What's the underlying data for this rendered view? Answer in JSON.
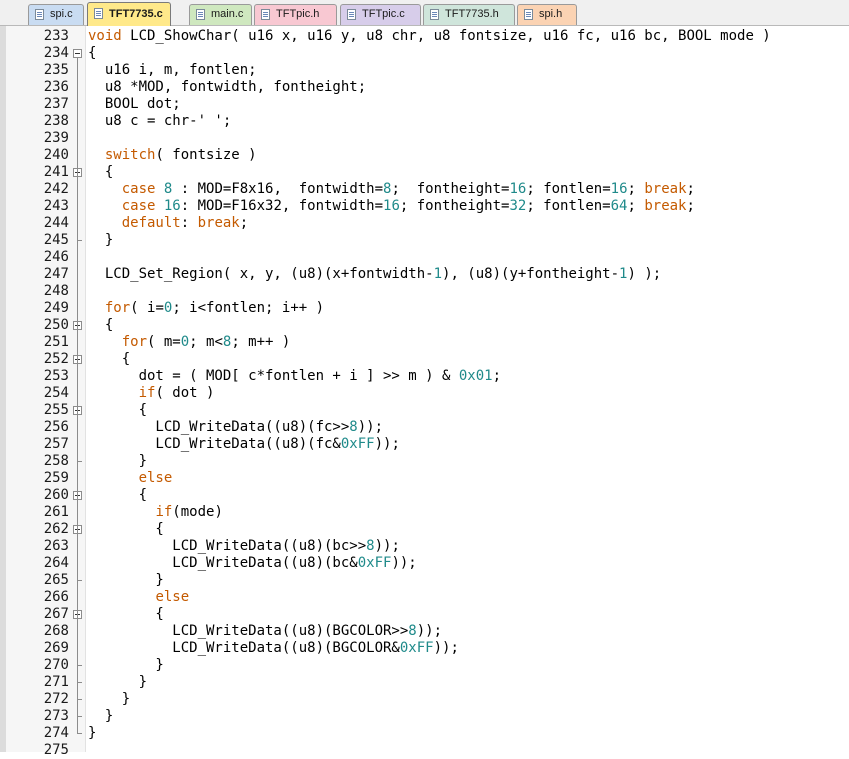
{
  "tabs": [
    {
      "label": "spi.c",
      "color": "#c9dcf2"
    },
    {
      "label": "TFT7735.c",
      "color": "#ffe98a",
      "active": true
    },
    {
      "label": "main.c",
      "color": "#cfe8bf"
    },
    {
      "label": "TFTpic.h",
      "color": "#f8c8d2"
    },
    {
      "label": "TFTpic.c",
      "color": "#d7cdea"
    },
    {
      "label": "TFT7735.h",
      "color": "#cfe5db"
    },
    {
      "label": "spi.h",
      "color": "#fbd3b3"
    }
  ],
  "colors": {
    "keyword": "#c45a00",
    "number": "#1f8a8a",
    "text": "#000000",
    "gutter": "#f6f6f6"
  },
  "editor": {
    "first_line": 233,
    "lines": [
      {
        "n": "233",
        "t": [
          [
            "void",
            "kw"
          ],
          [
            " LCD_ShowChar( u16 x, u16 y, u8 chr, u8 fontsize, u16 fc, u16 bc, BOOL mode )",
            ""
          ]
        ]
      },
      {
        "n": "234",
        "fold": true,
        "t": [
          [
            "{",
            ""
          ]
        ]
      },
      {
        "n": "235",
        "t": [
          [
            "  u16 i, m, fontlen;",
            ""
          ]
        ]
      },
      {
        "n": "236",
        "t": [
          [
            "  u8 *MOD, fontwidth, fontheight;",
            ""
          ]
        ]
      },
      {
        "n": "237",
        "t": [
          [
            "  BOOL dot;",
            ""
          ]
        ]
      },
      {
        "n": "238",
        "t": [
          [
            "  u8 c = chr-' ';",
            ""
          ]
        ]
      },
      {
        "n": "239",
        "t": []
      },
      {
        "n": "240",
        "t": [
          [
            "  ",
            ""
          ],
          [
            "switch",
            "kw"
          ],
          [
            "( fontsize )",
            ""
          ]
        ]
      },
      {
        "n": "241",
        "fold": true,
        "t": [
          [
            "  {",
            ""
          ]
        ]
      },
      {
        "n": "242",
        "t": [
          [
            "    ",
            ""
          ],
          [
            "case",
            "kw"
          ],
          [
            " ",
            ""
          ],
          [
            "8",
            "num"
          ],
          [
            " : MOD=F8x16,  fontwidth=",
            ""
          ],
          [
            "8",
            "num"
          ],
          [
            ";  fontheight=",
            ""
          ],
          [
            "16",
            "num"
          ],
          [
            "; fontlen=",
            ""
          ],
          [
            "16",
            "num"
          ],
          [
            "; ",
            ""
          ],
          [
            "break",
            "kw"
          ],
          [
            ";",
            ""
          ]
        ]
      },
      {
        "n": "243",
        "t": [
          [
            "    ",
            ""
          ],
          [
            "case",
            "kw"
          ],
          [
            " ",
            ""
          ],
          [
            "16",
            "num"
          ],
          [
            ": MOD=F16x32, fontwidth=",
            ""
          ],
          [
            "16",
            "num"
          ],
          [
            "; fontheight=",
            ""
          ],
          [
            "32",
            "num"
          ],
          [
            "; fontlen=",
            ""
          ],
          [
            "64",
            "num"
          ],
          [
            "; ",
            ""
          ],
          [
            "break",
            "kw"
          ],
          [
            ";",
            ""
          ]
        ]
      },
      {
        "n": "244",
        "t": [
          [
            "    ",
            ""
          ],
          [
            "default",
            "kw"
          ],
          [
            ": ",
            ""
          ],
          [
            "break",
            "kw"
          ],
          [
            ";",
            ""
          ]
        ]
      },
      {
        "n": "245",
        "t": [
          [
            "  }",
            ""
          ]
        ]
      },
      {
        "n": "246",
        "t": []
      },
      {
        "n": "247",
        "t": [
          [
            "  LCD_Set_Region( x, y, (u8)(x+fontwidth-",
            ""
          ],
          [
            "1",
            "num"
          ],
          [
            "), (u8)(y+fontheight-",
            ""
          ],
          [
            "1",
            "num"
          ],
          [
            ") );",
            ""
          ]
        ]
      },
      {
        "n": "248",
        "t": []
      },
      {
        "n": "249",
        "t": [
          [
            "  ",
            ""
          ],
          [
            "for",
            "kw"
          ],
          [
            "( i=",
            ""
          ],
          [
            "0",
            "num"
          ],
          [
            "; i<fontlen; i++ )",
            ""
          ]
        ]
      },
      {
        "n": "250",
        "fold": true,
        "t": [
          [
            "  {",
            ""
          ]
        ]
      },
      {
        "n": "251",
        "t": [
          [
            "    ",
            ""
          ],
          [
            "for",
            "kw"
          ],
          [
            "( m=",
            ""
          ],
          [
            "0",
            "num"
          ],
          [
            "; m<",
            ""
          ],
          [
            "8",
            "num"
          ],
          [
            "; m++ )",
            ""
          ]
        ]
      },
      {
        "n": "252",
        "fold": true,
        "t": [
          [
            "    {",
            ""
          ]
        ]
      },
      {
        "n": "253",
        "t": [
          [
            "      dot = ( MOD[ c*fontlen + i ] >> m ) & ",
            ""
          ],
          [
            "0x01",
            "num"
          ],
          [
            ";",
            ""
          ]
        ]
      },
      {
        "n": "254",
        "t": [
          [
            "      ",
            ""
          ],
          [
            "if",
            "kw"
          ],
          [
            "( dot )",
            ""
          ]
        ]
      },
      {
        "n": "255",
        "fold": true,
        "t": [
          [
            "      {",
            ""
          ]
        ]
      },
      {
        "n": "256",
        "t": [
          [
            "        LCD_WriteData((u8)(fc>>",
            ""
          ],
          [
            "8",
            "num"
          ],
          [
            "));",
            ""
          ]
        ]
      },
      {
        "n": "257",
        "t": [
          [
            "        LCD_WriteData((u8)(fc&",
            ""
          ],
          [
            "0xFF",
            "num"
          ],
          [
            "));",
            ""
          ]
        ]
      },
      {
        "n": "258",
        "t": [
          [
            "      }",
            ""
          ]
        ]
      },
      {
        "n": "259",
        "t": [
          [
            "      ",
            ""
          ],
          [
            "else",
            "kw"
          ]
        ]
      },
      {
        "n": "260",
        "fold": true,
        "t": [
          [
            "      {",
            ""
          ]
        ]
      },
      {
        "n": "261",
        "t": [
          [
            "        ",
            ""
          ],
          [
            "if",
            "kw"
          ],
          [
            "(mode)",
            ""
          ]
        ]
      },
      {
        "n": "262",
        "fold": true,
        "t": [
          [
            "        {",
            ""
          ]
        ]
      },
      {
        "n": "263",
        "t": [
          [
            "          LCD_WriteData((u8)(bc>>",
            ""
          ],
          [
            "8",
            "num"
          ],
          [
            "));",
            ""
          ]
        ]
      },
      {
        "n": "264",
        "t": [
          [
            "          LCD_WriteData((u8)(bc&",
            ""
          ],
          [
            "0xFF",
            "num"
          ],
          [
            "));",
            ""
          ]
        ]
      },
      {
        "n": "265",
        "t": [
          [
            "        }",
            ""
          ]
        ]
      },
      {
        "n": "266",
        "t": [
          [
            "        ",
            ""
          ],
          [
            "else",
            "kw"
          ]
        ]
      },
      {
        "n": "267",
        "fold": true,
        "t": [
          [
            "        {",
            ""
          ]
        ]
      },
      {
        "n": "268",
        "t": [
          [
            "          LCD_WriteData((u8)(BGCOLOR>>",
            ""
          ],
          [
            "8",
            "num"
          ],
          [
            "));",
            ""
          ]
        ]
      },
      {
        "n": "269",
        "t": [
          [
            "          LCD_WriteData((u8)(BGCOLOR&",
            ""
          ],
          [
            "0xFF",
            "num"
          ],
          [
            "));",
            ""
          ]
        ]
      },
      {
        "n": "270",
        "t": [
          [
            "        }",
            ""
          ]
        ]
      },
      {
        "n": "271",
        "t": [
          [
            "      }",
            ""
          ]
        ]
      },
      {
        "n": "272",
        "t": [
          [
            "    }",
            ""
          ]
        ]
      },
      {
        "n": "273",
        "t": [
          [
            "  }",
            ""
          ]
        ]
      },
      {
        "n": "274",
        "t": [
          [
            "}",
            ""
          ]
        ]
      },
      {
        "n": "275",
        "t": []
      }
    ]
  }
}
